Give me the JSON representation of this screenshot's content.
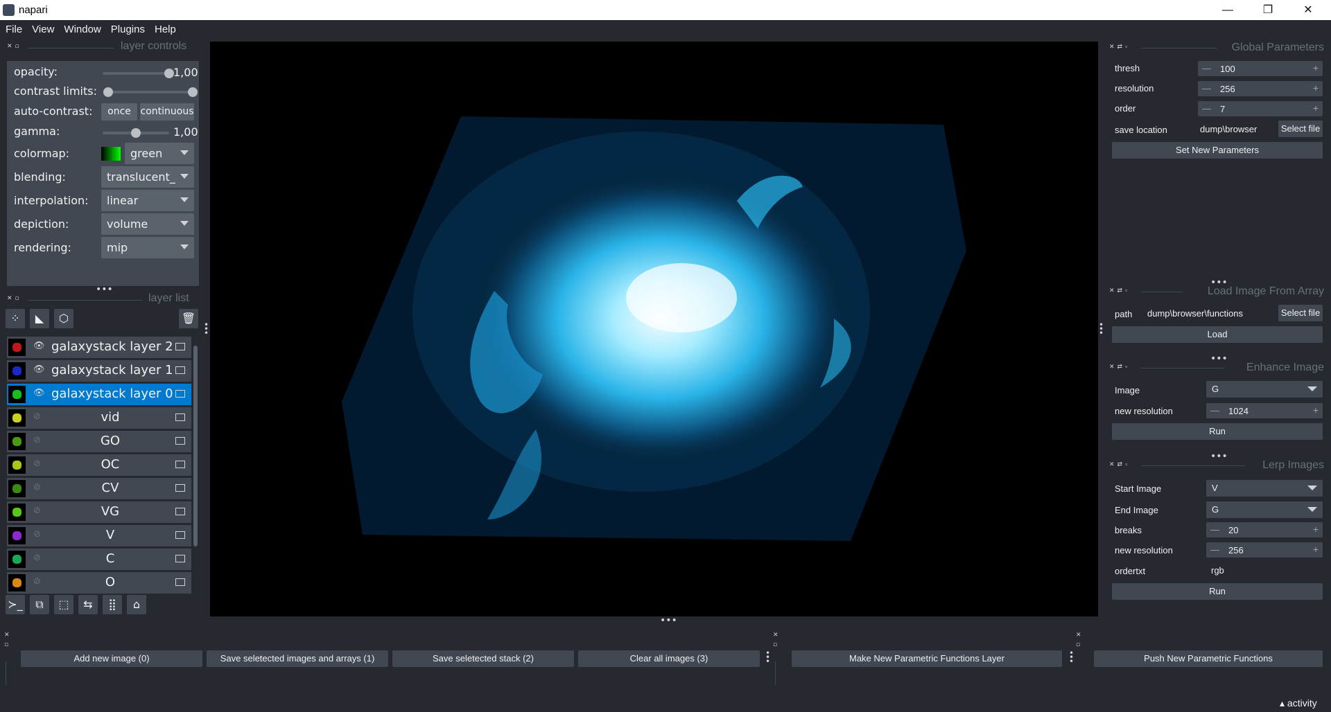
{
  "window": {
    "title": "napari",
    "minimize": "—",
    "maximize": "❐",
    "close": "✕"
  },
  "menu": [
    "File",
    "View",
    "Window",
    "Plugins",
    "Help"
  ],
  "layer_controls": {
    "header": "layer controls",
    "opacity_label": "opacity:",
    "opacity_value": "1,00",
    "opacity_level": 1.0,
    "contrast_label": "contrast limits:",
    "contrast_limits": [
      0.0,
      1.0
    ],
    "autocontrast_label": "auto-contrast:",
    "once": "once",
    "continuous": "continuous",
    "gamma_label": "gamma:",
    "gamma_value": "1,00",
    "gamma_level": 0.5,
    "colormap_label": "colormap:",
    "colormap_value": "green",
    "blending_label": "blending:",
    "blending_value": "translucent_",
    "interpolation_label": "interpolation:",
    "interpolation_value": "linear",
    "depiction_label": "depiction:",
    "depiction_value": "volume",
    "rendering_label": "rendering:",
    "rendering_value": "mip"
  },
  "layer_list": {
    "header": "layer list",
    "tools": [
      "points-icon",
      "shapes-icon",
      "labels-icon",
      "delete-icon"
    ],
    "layers": [
      {
        "name": "galaxystack layer 2",
        "visible": true,
        "selected": false,
        "thumb": "#c0181a"
      },
      {
        "name": "galaxystack layer 1",
        "visible": true,
        "selected": false,
        "thumb": "#1a28c8"
      },
      {
        "name": "galaxystack layer 0",
        "visible": true,
        "selected": true,
        "thumb": "#16c020"
      },
      {
        "name": "vid",
        "visible": false,
        "selected": false,
        "thumb": "#c8d020"
      },
      {
        "name": "GO",
        "visible": false,
        "selected": false,
        "thumb": "#4a9a10"
      },
      {
        "name": "OC",
        "visible": false,
        "selected": false,
        "thumb": "#a8c818"
      },
      {
        "name": "CV",
        "visible": false,
        "selected": false,
        "thumb": "#3a8a10"
      },
      {
        "name": "VG",
        "visible": false,
        "selected": false,
        "thumb": "#58c818"
      },
      {
        "name": "V",
        "visible": false,
        "selected": false,
        "thumb": "#8a2ad0"
      },
      {
        "name": "C",
        "visible": false,
        "selected": false,
        "thumb": "#18a858"
      },
      {
        "name": "O",
        "visible": false,
        "selected": false,
        "thumb": "#d88a18"
      }
    ]
  },
  "viewer_buttons": [
    "console-icon",
    "ndisplay-icon",
    "roll-icon",
    "transpose-icon",
    "grid-icon",
    "home-icon"
  ],
  "global_parameters": {
    "header": "Global Parameters",
    "thresh_label": "thresh",
    "thresh": "100",
    "resolution_label": "resolution",
    "resolution": "256",
    "order_label": "order",
    "order": "7",
    "save_label": "save location",
    "save_location": "dump\\browser",
    "select_file": "Select file",
    "set_button": "Set New Parameters"
  },
  "load_image": {
    "header": "Load Image From Array",
    "path_label": "path",
    "path": "dump\\browser\\functions",
    "select_file": "Select file",
    "load_button": "Load"
  },
  "enhance_image": {
    "header": "Enhance Image",
    "image_label": "Image",
    "image": "G",
    "res_label": "new resolution",
    "res": "1024",
    "run": "Run"
  },
  "lerp_images": {
    "header": "Lerp Images",
    "start_label": "Start Image",
    "start": "V",
    "end_label": "End Image",
    "end": "G",
    "breaks_label": "breaks",
    "breaks": "20",
    "res_label": "new resolution",
    "res": "256",
    "order_label": "ordertxt",
    "order": "rgb",
    "run": "Run"
  },
  "bottom_buttons": {
    "add": "Add new image (0)",
    "save_images": "Save seletected images and arrays (1)",
    "save_stack": "Save seletected stack (2)",
    "clear": "Clear all images (3)",
    "make_layer": "Make New Parametric Functions Layer",
    "push": "Push New Parametric Functions"
  },
  "status": {
    "activity": "activity"
  },
  "colors": {
    "accent": "#007acc",
    "background": "#262930",
    "panel": "#414851"
  }
}
